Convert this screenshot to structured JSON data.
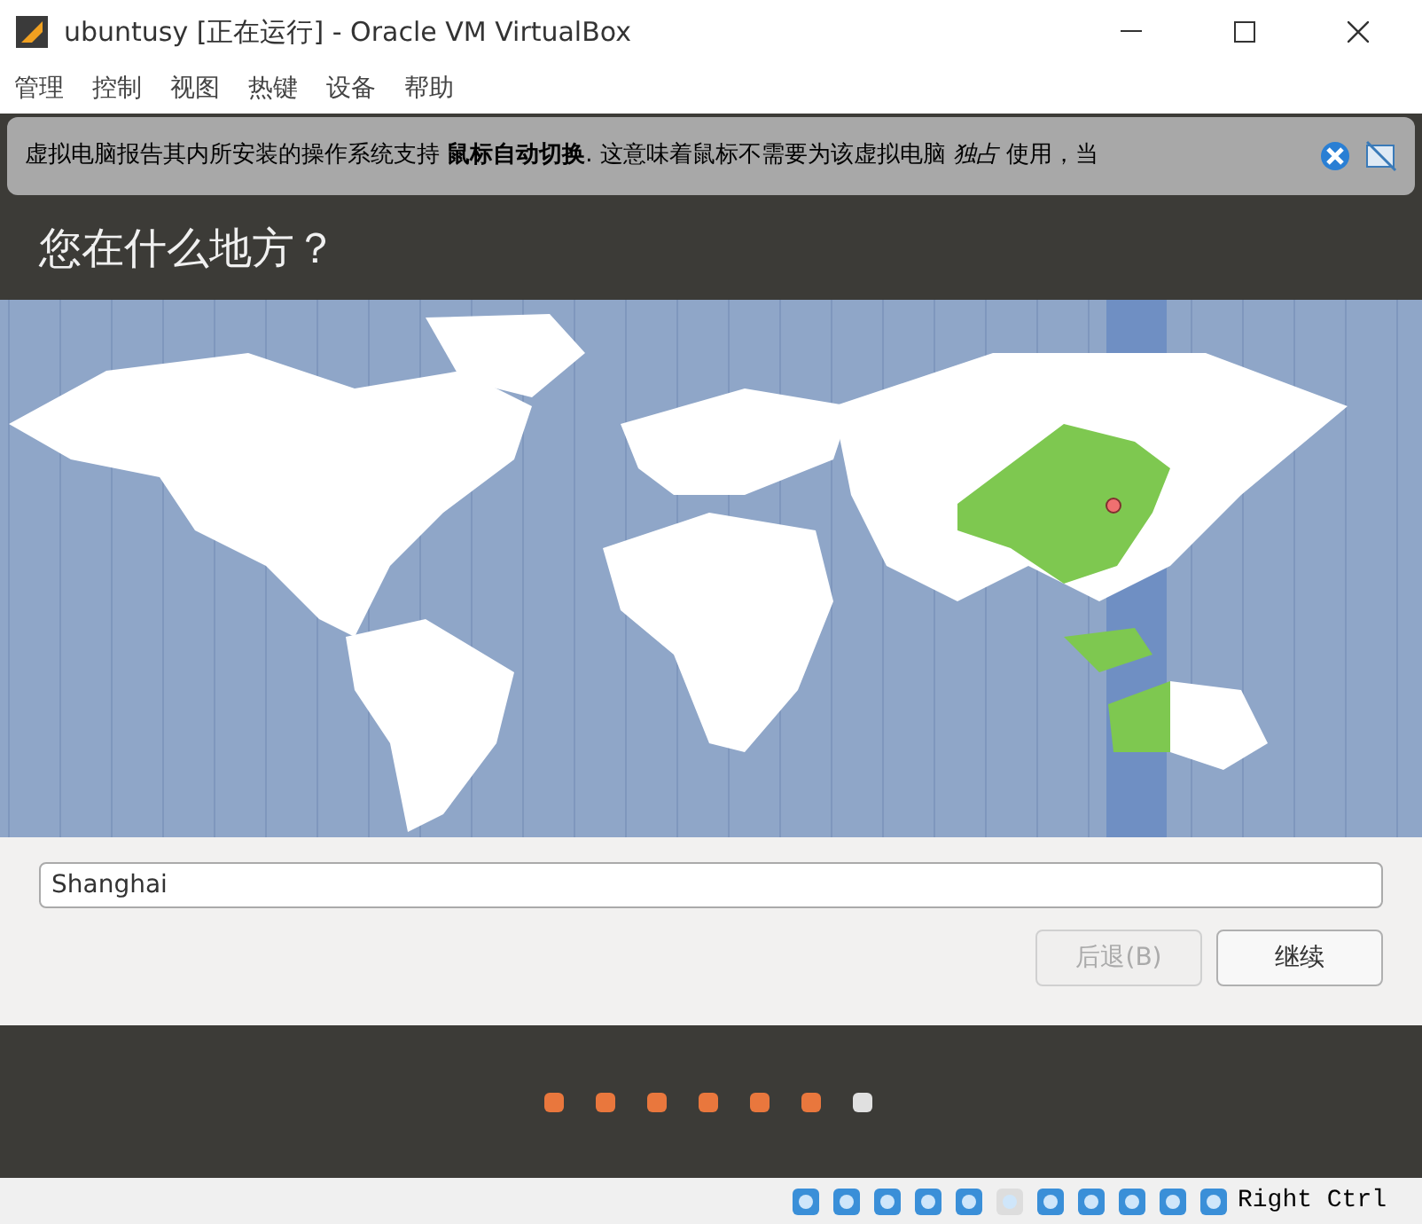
{
  "window": {
    "title": "ubuntusy [正在运行] - Oracle VM VirtualBox"
  },
  "menu": [
    "管理",
    "控制",
    "视图",
    "热键",
    "设备",
    "帮助"
  ],
  "notification": {
    "text": "虚拟电脑报告其内所安装的操作系统支持 **鼠标自动切换**. 这意味着鼠标不需要为该虚拟电脑 *独占* 使用，当"
  },
  "installer": {
    "heading": "您在什么地方？",
    "location": {
      "value": "Shanghai"
    },
    "buttons": [
      {
        "label": "后退(B)",
        "disabled": true
      },
      {
        "label": "继续",
        "disabled": false
      }
    ],
    "steps": [
      {
        "current": false
      },
      {
        "current": false
      },
      {
        "current": false
      },
      {
        "current": false
      },
      {
        "current": false
      },
      {
        "current": false
      },
      {
        "current": true
      }
    ]
  },
  "status_bar": {
    "host_key": "Right Ctrl"
  }
}
